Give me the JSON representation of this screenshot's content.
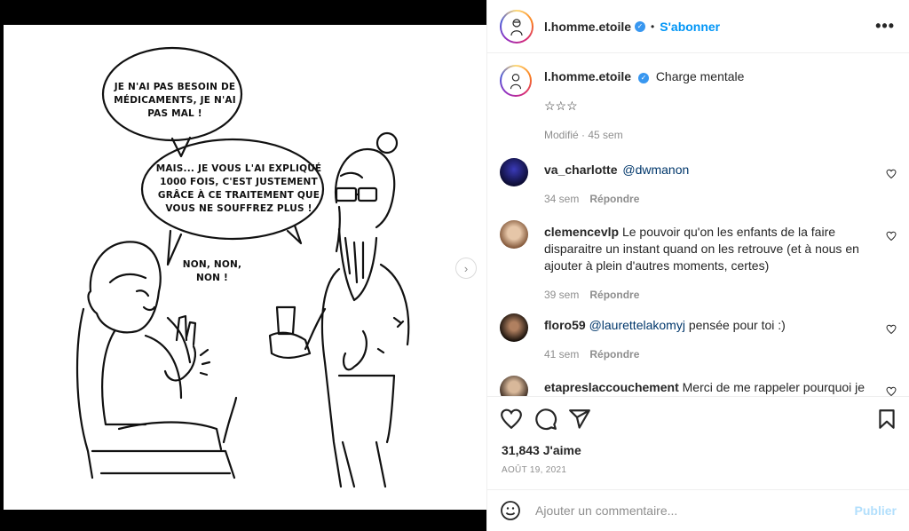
{
  "comic": {
    "bubble1": "Je n'ai pas besoin de médicaments, je n'ai pas mal !",
    "bubble2": "Mais... je vous l'ai expliqué 1000 fois, c'est justement grâce à ce traitement que vous ne souffrez plus !",
    "non": "Non, non, non !"
  },
  "header": {
    "username": "l.homme.etoile",
    "follow_label": "S'abonner",
    "more_label": "•••"
  },
  "caption": {
    "username": "l.homme.etoile",
    "text": "Charge mentale",
    "stars": "☆☆☆",
    "edited": "Modifié · 45 sem"
  },
  "comments": [
    {
      "username": "va_charlotte",
      "mention": "@dwmanon",
      "text": "",
      "time": "34 sem",
      "reply": "Répondre"
    },
    {
      "username": "clemencevlp",
      "mention": "",
      "text": "Le pouvoir qu'on les enfants de la faire disparaitre un instant quand on les retrouve (et à nous en ajouter à plein d'autres moments, certes)",
      "time": "39 sem",
      "reply": "Répondre"
    },
    {
      "username": "floro59",
      "mention": "@laurettelakomyj",
      "text": "pensée pour toi :)",
      "time": "41 sem",
      "reply": "Répondre"
    },
    {
      "username": "etapreslaccouchement",
      "mention": "",
      "text": "Merci de me rappeler pourquoi je",
      "time": "",
      "reply": ""
    }
  ],
  "actions": {
    "likes": "31,843 J'aime",
    "date": "AOÛT 19, 2021"
  },
  "add_comment": {
    "placeholder": "Ajouter un commentaire...",
    "publish_label": "Publier"
  },
  "colors": {
    "accent": "#0095f6",
    "verified": "#3897f0",
    "muted": "#8e8e8e",
    "publish_disabled": "#b2dffc"
  },
  "icons": [
    "verified-icon",
    "more-icon",
    "heart-icon",
    "comment-icon",
    "share-icon",
    "bookmark-icon",
    "emoji-icon",
    "chevron-right-icon"
  ]
}
